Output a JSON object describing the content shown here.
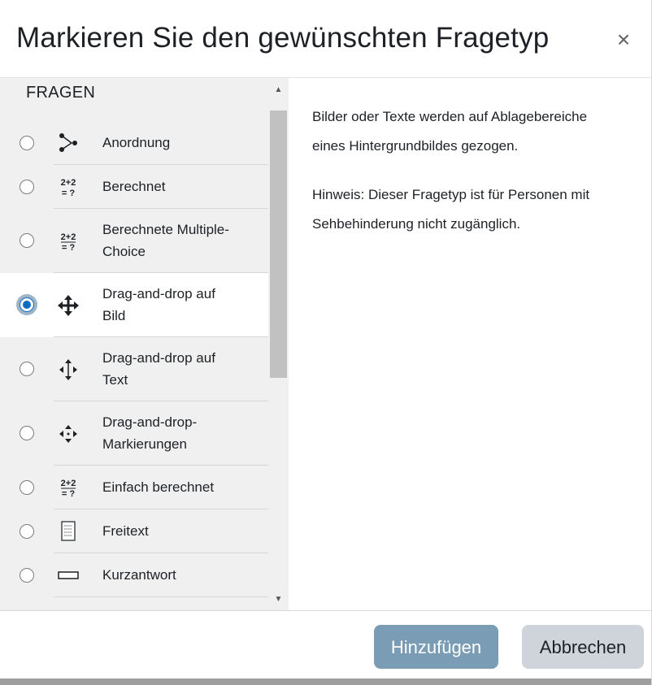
{
  "dialog": {
    "title": "Markieren Sie den gewünschten Fragetyp",
    "close_symbol": "×"
  },
  "left_pane": {
    "section_title": "FRAGEN",
    "items": [
      {
        "label": "Anordnung",
        "icon": "ordering-icon",
        "selected": false
      },
      {
        "label": "Berechnet",
        "icon": "calculated-icon",
        "selected": false
      },
      {
        "label": "Berechnete Multiple-Choice",
        "icon": "calculated-multichoice-icon",
        "selected": false
      },
      {
        "label": "Drag-and-drop auf Bild",
        "icon": "move-icon",
        "selected": true
      },
      {
        "label": "Drag-and-drop auf Text",
        "icon": "drag-text-icon",
        "selected": false
      },
      {
        "label": "Drag-and-drop-Markierungen",
        "icon": "drag-markers-icon",
        "selected": false
      },
      {
        "label": "Einfach berechnet",
        "icon": "simple-calculated-icon",
        "selected": false
      },
      {
        "label": "Freitext",
        "icon": "essay-icon",
        "selected": false
      },
      {
        "label": "Kurzantwort",
        "icon": "shortanswer-icon",
        "selected": false
      }
    ]
  },
  "right_pane": {
    "description": "Bilder oder Texte werden auf Ablagebereiche eines Hintergrundbildes gezogen.",
    "note": "Hinweis: Dieser Fragetyp ist für Personen mit Sehbehinderung nicht zugänglich."
  },
  "footer": {
    "add_label": "Hinzufügen",
    "cancel_label": "Abbrechen"
  },
  "colors": {
    "primary_button": "#7a9cb5",
    "secondary_button": "#ced4da",
    "left_pane_bg": "#f0f0f0",
    "radio_selected": "#0f6cbf"
  }
}
